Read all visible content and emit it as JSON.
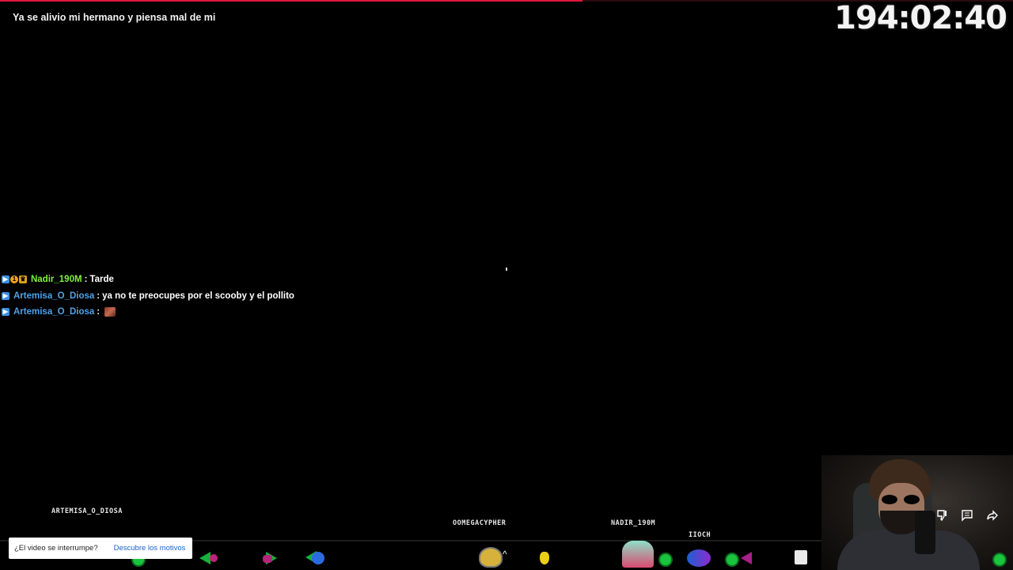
{
  "player": {
    "progress_fraction": 0.575,
    "title": "Ya se alivio mi hermano y piensa mal de mi",
    "timer": "194:02:40"
  },
  "chat": {
    "messages": [
      {
        "user": "Nadir_190M",
        "user_color": "#7ef23c",
        "message": "Tarde",
        "badges": [
          "badge-blue",
          "badge-orange",
          "badge-gold"
        ]
      },
      {
        "user": "Artemisa_O_Diosa",
        "user_color": "#4ea3ea",
        "message": "ya no te preocupes por el scooby y el pollito",
        "badges": [
          "badge-blue"
        ]
      },
      {
        "user": "Artemisa_O_Diosa",
        "user_color": "#4ea3ea",
        "message": "",
        "emote": "emote-icon",
        "badges": [
          "badge-blue"
        ]
      }
    ],
    "separator": ":"
  },
  "overlay_names": {
    "artemisa": "ARTEMISA_O_DIOSA",
    "omega": "OOMEGACYPHER",
    "nadir": "NADIR_190M",
    "iioch": "IIOCH"
  },
  "notice": {
    "text": "¿El video se interrumpe?",
    "link": "Descubre los motivos"
  },
  "actions": {
    "dislike_icon": "thumbs-down-icon",
    "comments_icon": "comment-icon",
    "share_icon": "share-icon"
  },
  "colors": {
    "progress": "#e0173d",
    "link": "#1a64c8"
  }
}
